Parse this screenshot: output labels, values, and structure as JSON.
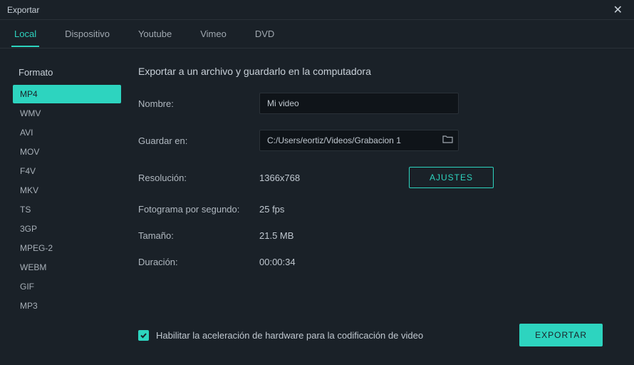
{
  "window": {
    "title": "Exportar"
  },
  "tabs": [
    {
      "label": "Local",
      "active": true
    },
    {
      "label": "Dispositivo",
      "active": false
    },
    {
      "label": "Youtube",
      "active": false
    },
    {
      "label": "Vimeo",
      "active": false
    },
    {
      "label": "DVD",
      "active": false
    }
  ],
  "sidebar": {
    "title": "Formato",
    "items": [
      {
        "label": "MP4",
        "active": true
      },
      {
        "label": "WMV",
        "active": false
      },
      {
        "label": "AVI",
        "active": false
      },
      {
        "label": "MOV",
        "active": false
      },
      {
        "label": "F4V",
        "active": false
      },
      {
        "label": "MKV",
        "active": false
      },
      {
        "label": "TS",
        "active": false
      },
      {
        "label": "3GP",
        "active": false
      },
      {
        "label": "MPEG-2",
        "active": false
      },
      {
        "label": "WEBM",
        "active": false
      },
      {
        "label": "GIF",
        "active": false
      },
      {
        "label": "MP3",
        "active": false
      }
    ]
  },
  "main": {
    "title": "Exportar a un archivo y guardarlo en la computadora",
    "name_label": "Nombre:",
    "name_value": "Mi video",
    "save_label": "Guardar en:",
    "save_value": "C:/Users/eortiz/Videos/Grabacion 1",
    "resolution_label": "Resolución:",
    "resolution_value": "1366x768",
    "ajustes_label": "AJUSTES",
    "fps_label": "Fotograma por segundo:",
    "fps_value": "25 fps",
    "size_label": "Tamaño:",
    "size_value": "21.5 MB",
    "duration_label": "Duración:",
    "duration_value": "00:00:34"
  },
  "footer": {
    "hw_accel_label": "Habilitar la aceleración de hardware para la codificación de video",
    "hw_accel_checked": true,
    "export_label": "EXPORTAR"
  }
}
